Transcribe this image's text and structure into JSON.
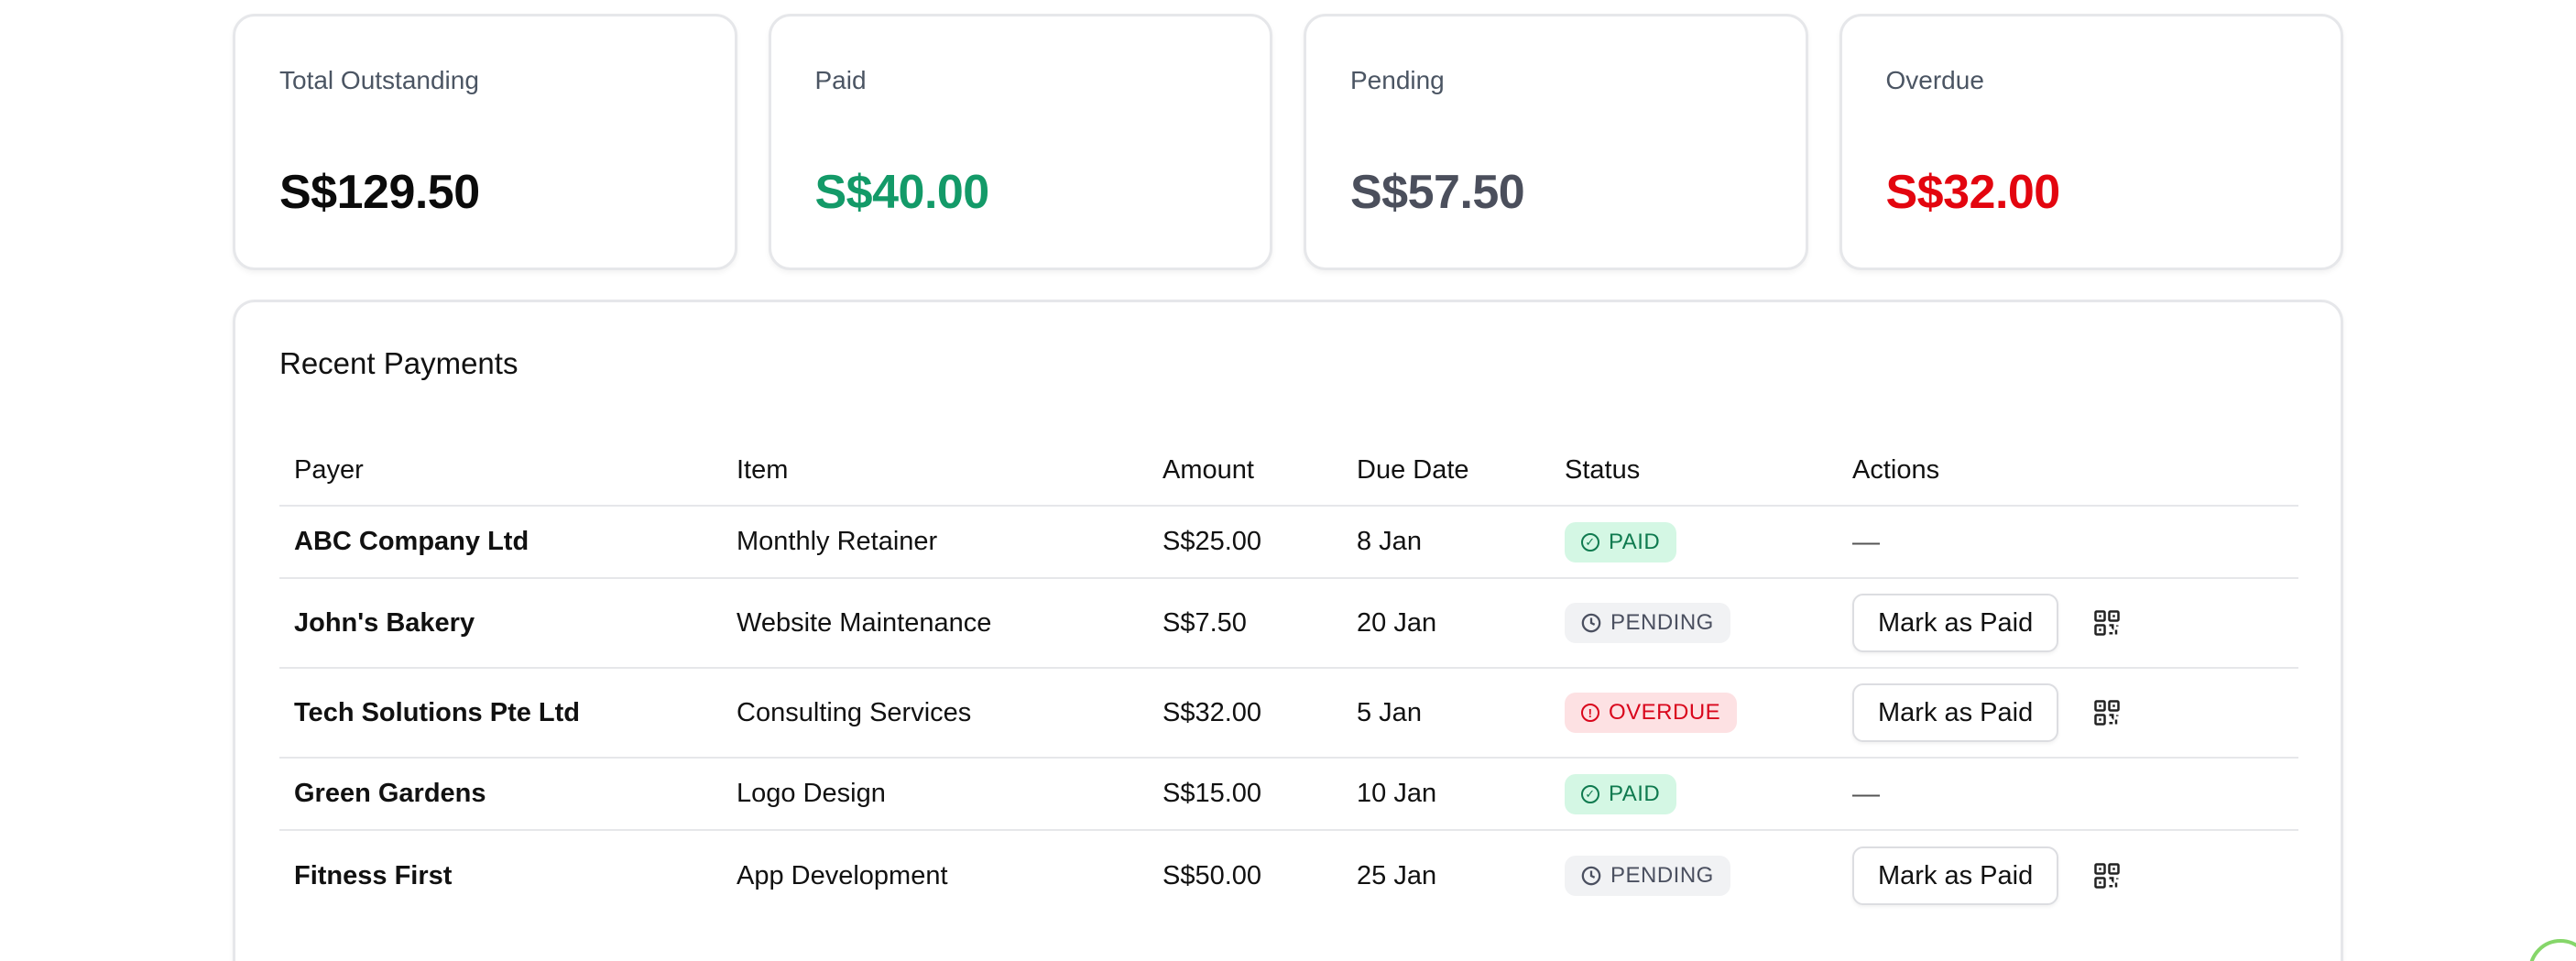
{
  "stats": [
    {
      "label": "Total Outstanding",
      "value": "S$129.50",
      "color": "#0b0b0b"
    },
    {
      "label": "Paid",
      "value": "S$40.00",
      "color": "#139a68"
    },
    {
      "label": "Pending",
      "value": "S$57.50",
      "color": "#4b4f5c"
    },
    {
      "label": "Overdue",
      "value": "S$32.00",
      "color": "#e3050f"
    }
  ],
  "payments": {
    "title": "Recent Payments",
    "columns": [
      "Payer",
      "Item",
      "Amount",
      "Due Date",
      "Status",
      "Actions"
    ],
    "rows": [
      {
        "payer": "ABC Company Ltd",
        "item": "Monthly Retainer",
        "amount": "S$25.00",
        "due": "8 Jan",
        "status": "PAID",
        "status_icon": "check-circle-icon",
        "action": "—"
      },
      {
        "payer": "John's Bakery",
        "item": "Website Maintenance",
        "amount": "S$7.50",
        "due": "20 Jan",
        "status": "PENDING",
        "status_icon": "clock-icon",
        "action": "Mark as Paid",
        "action_icon": "qr-code-icon"
      },
      {
        "payer": "Tech Solutions Pte Ltd",
        "item": "Consulting Services",
        "amount": "S$32.00",
        "due": "5 Jan",
        "status": "OVERDUE",
        "status_icon": "alert-circle-icon",
        "action": "Mark as Paid",
        "action_icon": "qr-code-icon"
      },
      {
        "payer": "Green Gardens",
        "item": "Logo Design",
        "amount": "S$15.00",
        "due": "10 Jan",
        "status": "PAID",
        "status_icon": "check-circle-icon",
        "action": "—"
      },
      {
        "payer": "Fitness First",
        "item": "App Development",
        "amount": "S$50.00",
        "due": "25 Jan",
        "status": "PENDING",
        "status_icon": "clock-icon",
        "action": "Mark as Paid",
        "action_icon": "qr-code-icon"
      }
    ]
  },
  "colors": {
    "paid_badge_bg": "#d4f7e4",
    "pending_badge_bg": "#f1f2f4",
    "overdue_badge_bg": "#fde1e3"
  }
}
